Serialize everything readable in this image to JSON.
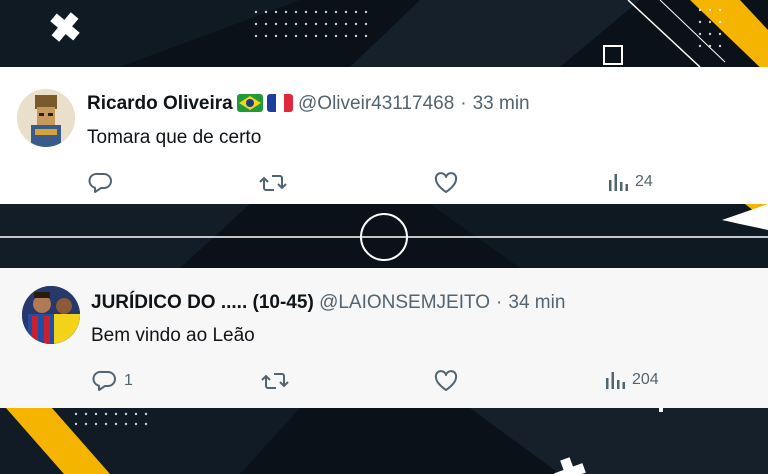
{
  "colors": {
    "background": "#0a1118",
    "accent_yellow": "#f5b400",
    "card_bg": "#ffffff",
    "card_bg_alt": "#f7f7f7",
    "text_primary": "#0f1419",
    "text_secondary": "#536471"
  },
  "posts": [
    {
      "author_name": "Ricardo Oliveira",
      "flags": [
        "brazil-flag",
        "france-flag"
      ],
      "handle": "@Oliveir43117468",
      "separator": "·",
      "time": "33 min",
      "text": "Tomara que de certo",
      "replies": "",
      "reposts": "",
      "likes": "",
      "views": "24",
      "icons": [
        "reply-icon",
        "repost-icon",
        "like-icon",
        "views-icon"
      ]
    },
    {
      "author_name": "JURÍDICO DO ..... (10-45)",
      "handle": "@LAIONSEMJEITO",
      "separator": "·",
      "time": "34 min",
      "text": "Bem vindo ao Leão",
      "replies": "1",
      "reposts": "",
      "likes": "",
      "views": "204",
      "icons": [
        "reply-icon",
        "repost-icon",
        "like-icon",
        "views-icon"
      ]
    }
  ]
}
